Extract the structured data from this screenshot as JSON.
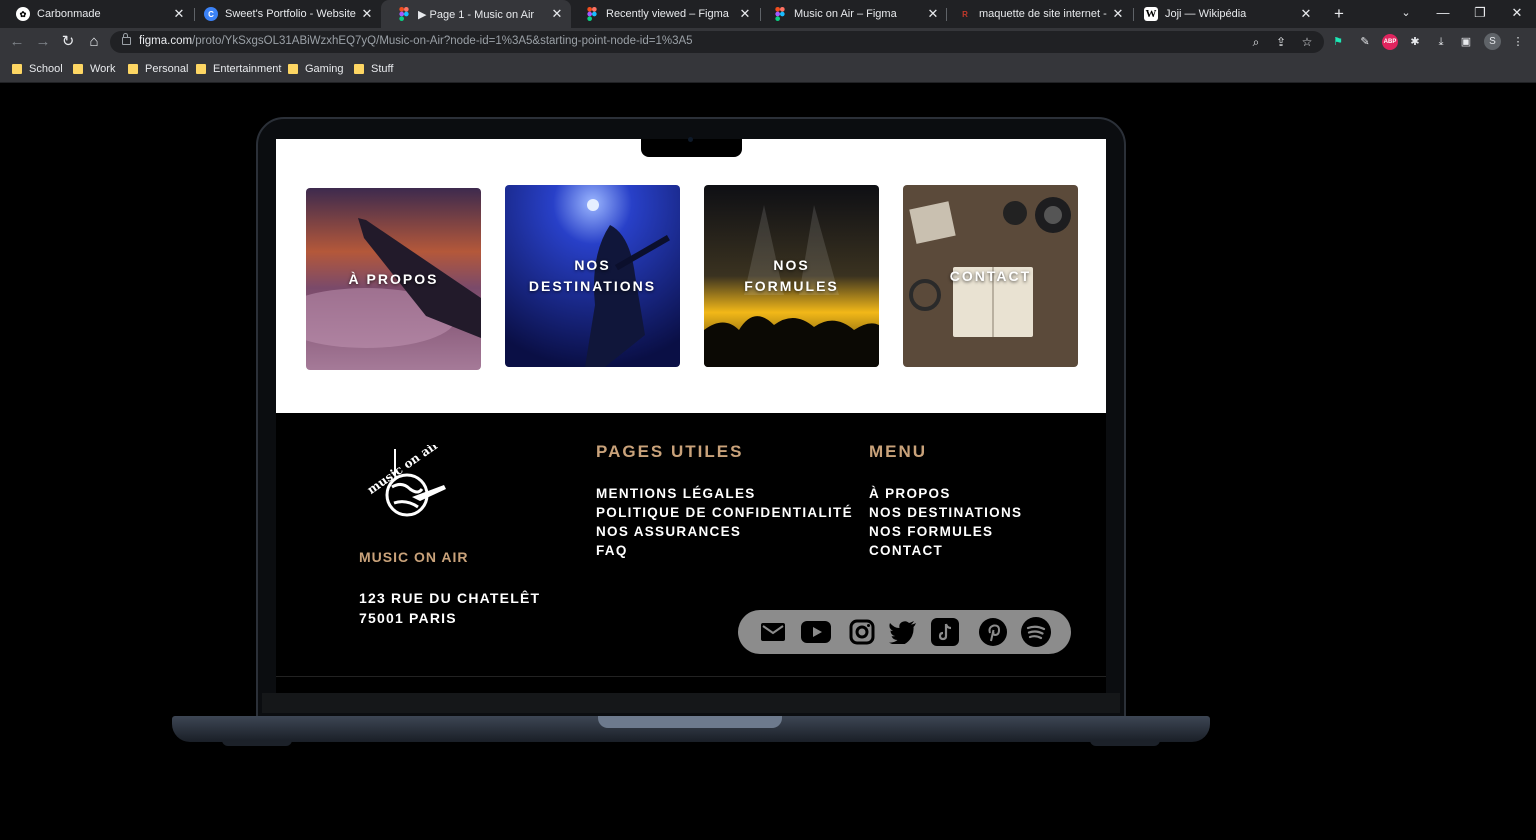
{
  "browser": {
    "tabs": [
      {
        "title": "Carbonmade",
        "favicon": "carbonmade-icon"
      },
      {
        "title": "Sweet's Portfolio - Website",
        "favicon": "portfolio-icon"
      },
      {
        "title": "▶ Page 1 - Music on Air",
        "favicon": "figma-icon",
        "active": true
      },
      {
        "title": "Recently viewed – Figma",
        "favicon": "figma-icon"
      },
      {
        "title": "Music on Air – Figma",
        "favicon": "figma-icon"
      },
      {
        "title": "maquette de site internet - trad",
        "favicon": "translate-icon"
      },
      {
        "title": "Joji — Wikipédia",
        "favicon": "wikipedia-icon"
      }
    ],
    "url_host": "figma.com",
    "url_path": "/proto/YkSxgsOL31ABiWzxhEQ7yQ/Music-on-Air?node-id=1%3A5&starting-point-node-id=1%3A5",
    "profile_initial": "S",
    "bookmarks": [
      "School",
      "Work",
      "Personal",
      "Entertainment",
      "Gaming",
      "Stuff"
    ]
  },
  "site": {
    "cards": [
      {
        "label": "À PROPOS"
      },
      {
        "label": "NOS\nDESTINATIONS"
      },
      {
        "label": "NOS\nFORMULES"
      },
      {
        "label": "CONTACT"
      }
    ],
    "logo_text": "music on air",
    "brand": "MUSIC ON AIR",
    "address_line1": "123 RUE DU CHATELÊT",
    "address_line2": "75001 PARIS",
    "useful_pages": {
      "title": "PAGES UTILES",
      "items": [
        "MENTIONS LÉGALES",
        "POLITIQUE DE CONFIDENTIALITÉ",
        "NOS ASSURANCES",
        "FAQ"
      ]
    },
    "menu": {
      "title": "MENU",
      "items": [
        "À PROPOS",
        "NOS DESTINATIONS",
        "NOS FORMULES",
        "CONTACT"
      ]
    },
    "social_icons": [
      "mail-icon",
      "youtube-icon",
      "instagram-icon",
      "twitter-icon",
      "tiktok-icon",
      "pinterest-icon",
      "spotify-icon"
    ],
    "colors": {
      "accent": "#c9a27a",
      "background": "#000000",
      "social_bar": "#8c8c8c"
    }
  }
}
